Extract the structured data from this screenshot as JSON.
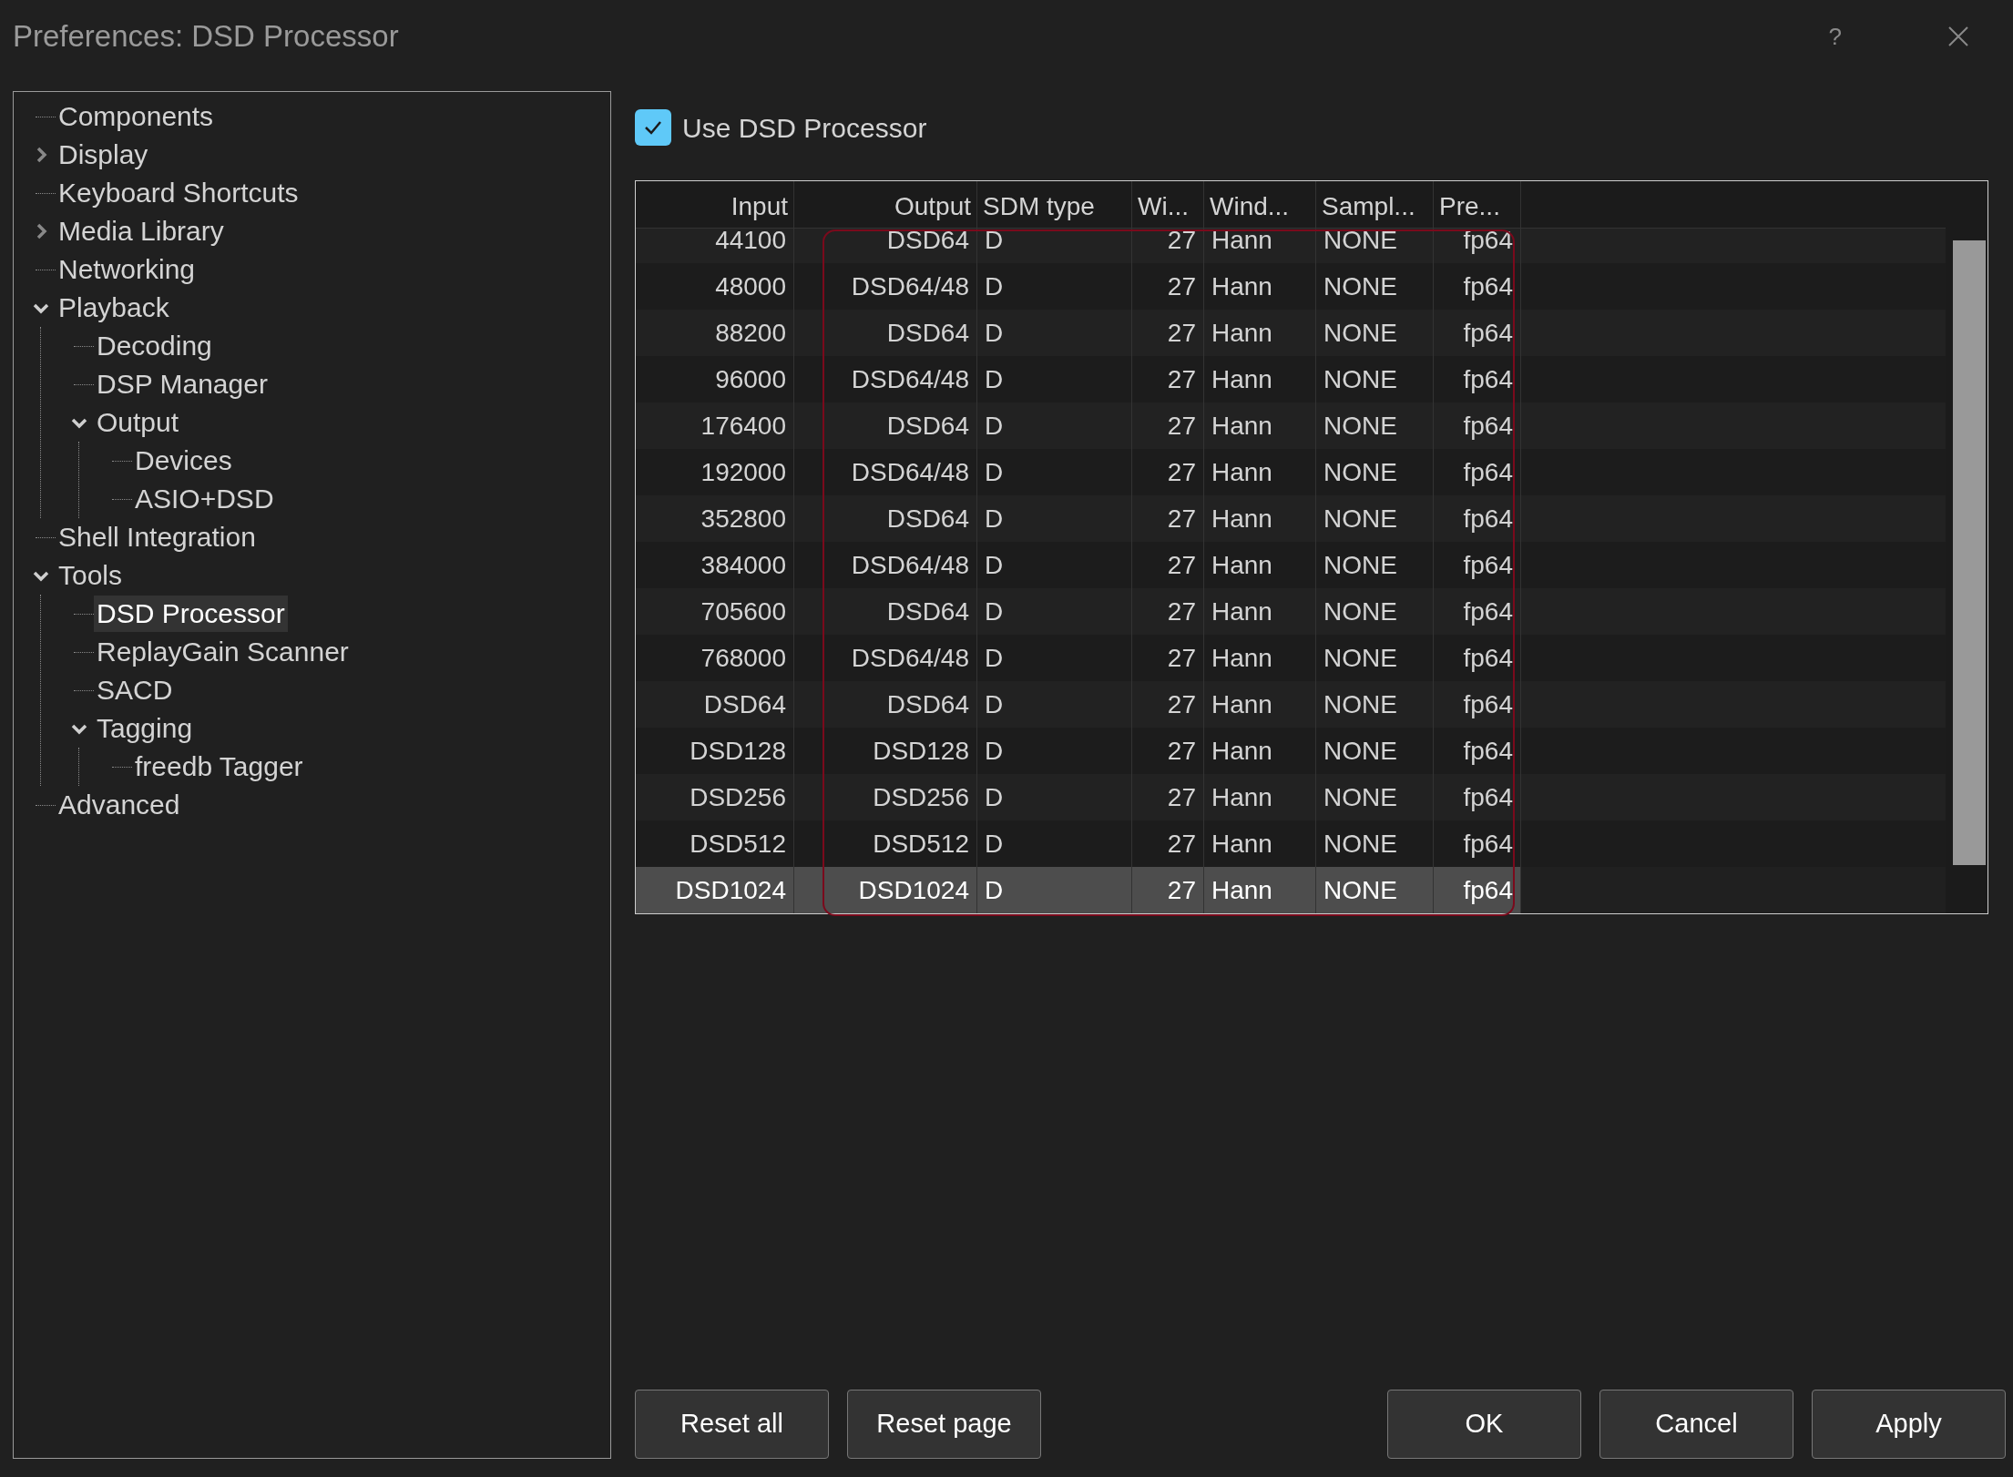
{
  "window": {
    "title": "Preferences: DSD Processor",
    "help": "?"
  },
  "tree": [
    {
      "label": "Components",
      "selected": false
    },
    {
      "label": "Display",
      "selected": false,
      "expanded": false
    },
    {
      "label": "Keyboard Shortcuts",
      "selected": false
    },
    {
      "label": "Media Library",
      "selected": false,
      "expanded": false
    },
    {
      "label": "Networking",
      "selected": false
    },
    {
      "label": "Playback",
      "selected": false,
      "expanded": true,
      "children": [
        {
          "label": "Decoding",
          "selected": false
        },
        {
          "label": "DSP Manager",
          "selected": false
        },
        {
          "label": "Output",
          "selected": false,
          "expanded": true,
          "children": [
            {
              "label": "Devices",
              "selected": false
            },
            {
              "label": "ASIO+DSD",
              "selected": false
            }
          ]
        }
      ]
    },
    {
      "label": "Shell Integration",
      "selected": false
    },
    {
      "label": "Tools",
      "selected": false,
      "expanded": true,
      "children": [
        {
          "label": "DSD Processor",
          "selected": true
        },
        {
          "label": "ReplayGain Scanner",
          "selected": false
        },
        {
          "label": "SACD",
          "selected": false
        },
        {
          "label": "Tagging",
          "selected": false,
          "expanded": true,
          "children": [
            {
              "label": "freedb Tagger",
              "selected": false
            }
          ]
        }
      ]
    },
    {
      "label": "Advanced",
      "selected": false
    }
  ],
  "use_processor": {
    "label": "Use DSD Processor",
    "checked": true
  },
  "table": {
    "columns": [
      "Input",
      "Output",
      "SDM type",
      "Wi...",
      "Wind...",
      "Sampl...",
      "Pre..."
    ],
    "rows": [
      {
        "cells": [
          "44100",
          "DSD64",
          "D",
          "27",
          "Hann",
          "NONE",
          "fp64"
        ],
        "selected": false
      },
      {
        "cells": [
          "48000",
          "DSD64/48",
          "D",
          "27",
          "Hann",
          "NONE",
          "fp64"
        ],
        "selected": false
      },
      {
        "cells": [
          "88200",
          "DSD64",
          "D",
          "27",
          "Hann",
          "NONE",
          "fp64"
        ],
        "selected": false
      },
      {
        "cells": [
          "96000",
          "DSD64/48",
          "D",
          "27",
          "Hann",
          "NONE",
          "fp64"
        ],
        "selected": false
      },
      {
        "cells": [
          "176400",
          "DSD64",
          "D",
          "27",
          "Hann",
          "NONE",
          "fp64"
        ],
        "selected": false
      },
      {
        "cells": [
          "192000",
          "DSD64/48",
          "D",
          "27",
          "Hann",
          "NONE",
          "fp64"
        ],
        "selected": false
      },
      {
        "cells": [
          "352800",
          "DSD64",
          "D",
          "27",
          "Hann",
          "NONE",
          "fp64"
        ],
        "selected": false
      },
      {
        "cells": [
          "384000",
          "DSD64/48",
          "D",
          "27",
          "Hann",
          "NONE",
          "fp64"
        ],
        "selected": false
      },
      {
        "cells": [
          "705600",
          "DSD64",
          "D",
          "27",
          "Hann",
          "NONE",
          "fp64"
        ],
        "selected": false
      },
      {
        "cells": [
          "768000",
          "DSD64/48",
          "D",
          "27",
          "Hann",
          "NONE",
          "fp64"
        ],
        "selected": false
      },
      {
        "cells": [
          "DSD64",
          "DSD64",
          "D",
          "27",
          "Hann",
          "NONE",
          "fp64"
        ],
        "selected": false
      },
      {
        "cells": [
          "DSD128",
          "DSD128",
          "D",
          "27",
          "Hann",
          "NONE",
          "fp64"
        ],
        "selected": false
      },
      {
        "cells": [
          "DSD256",
          "DSD256",
          "D",
          "27",
          "Hann",
          "NONE",
          "fp64"
        ],
        "selected": false
      },
      {
        "cells": [
          "DSD512",
          "DSD512",
          "D",
          "27",
          "Hann",
          "NONE",
          "fp64"
        ],
        "selected": false
      },
      {
        "cells": [
          "DSD1024",
          "DSD1024",
          "D",
          "27",
          "Hann",
          "NONE",
          "fp64"
        ],
        "selected": true
      }
    ]
  },
  "buttons_left": [
    "Reset all",
    "Reset page"
  ],
  "buttons_right": [
    "OK",
    "Cancel",
    "Apply"
  ]
}
